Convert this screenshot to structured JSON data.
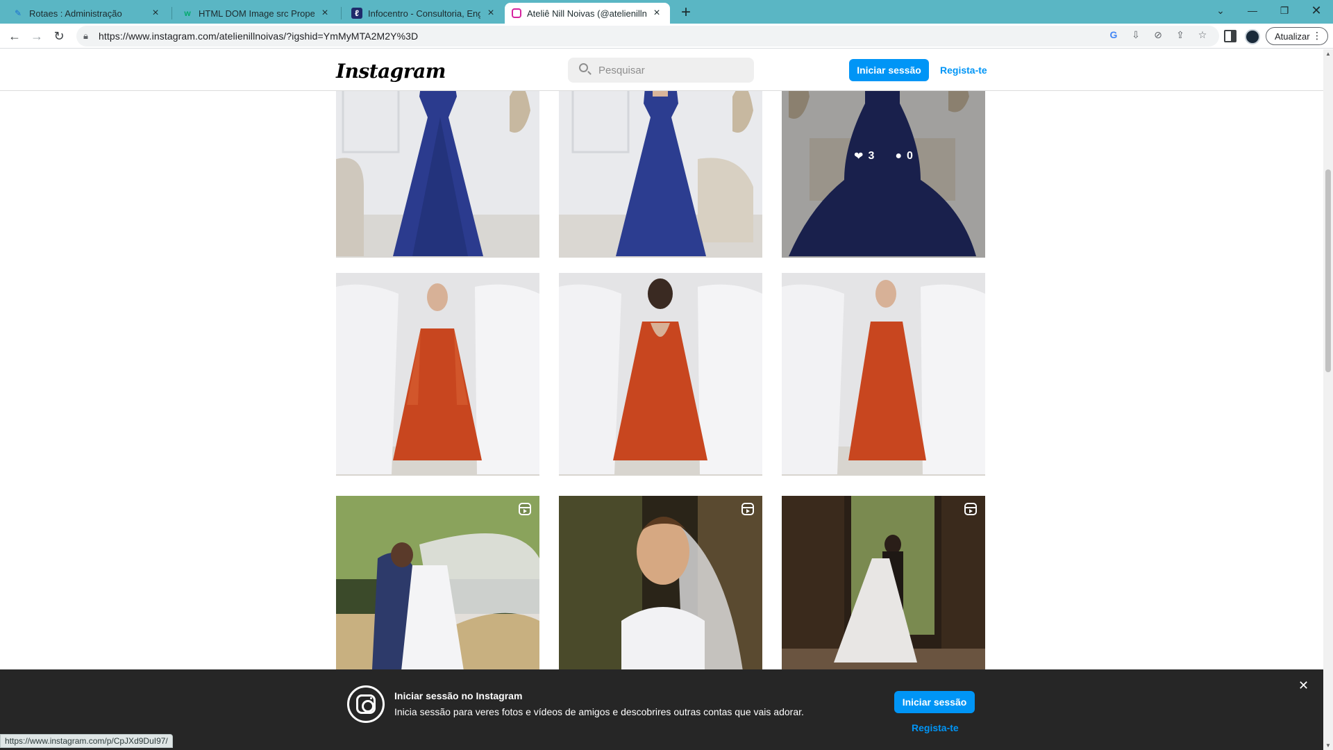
{
  "browser": {
    "tabs": [
      {
        "title": "Rotaes : Administração",
        "favicon": "feather-icon"
      },
      {
        "title": "HTML DOM Image src Property",
        "favicon": "w3schools-icon"
      },
      {
        "title": "Infocentro - Consultoria, Engenh",
        "favicon": "infocentro-icon"
      },
      {
        "title": "Ateliê Nill Noivas (@atelienillnoiv",
        "favicon": "instagram-icon",
        "active": true
      }
    ],
    "url": "https://www.instagram.com/atelienillnoivas/?igshid=YmMyMTA2M2Y%3D",
    "update_label": "Atualizar",
    "status_url": "https://www.instagram.com/p/CpJXd9DuI97/"
  },
  "instagram": {
    "logo": "Instagram",
    "search_placeholder": "Pesquisar",
    "login_label": "Iniciar sessão",
    "register_label": "Regista-te",
    "accent_color": "#0095f6"
  },
  "grid": {
    "posts": [
      {
        "kind": "photo",
        "scene": "blue-gown-front",
        "reel": false
      },
      {
        "kind": "photo",
        "scene": "blue-gown-back",
        "reel": false
      },
      {
        "kind": "photo",
        "scene": "blue-gown-seated",
        "reel": false,
        "hover": {
          "likes": "3",
          "comments": "0"
        }
      },
      {
        "kind": "photo",
        "scene": "orange-gown-front",
        "reel": false
      },
      {
        "kind": "photo",
        "scene": "orange-gown-back",
        "reel": false
      },
      {
        "kind": "photo",
        "scene": "orange-gown-side",
        "reel": false
      },
      {
        "kind": "reel",
        "scene": "wedding-couple-veil",
        "reel": true
      },
      {
        "kind": "reel",
        "scene": "bride-portrait",
        "reel": true
      },
      {
        "kind": "reel",
        "scene": "couple-silhouette",
        "reel": true
      }
    ]
  },
  "banner": {
    "title": "Iniciar sessão no Instagram",
    "subtitle": "Inicia sessão para veres fotos e vídeos de amigos e descobrires outras contas que vais adorar.",
    "login_label": "Iniciar sessão",
    "register_label": "Regista-te",
    "close_icon": "close-icon"
  }
}
